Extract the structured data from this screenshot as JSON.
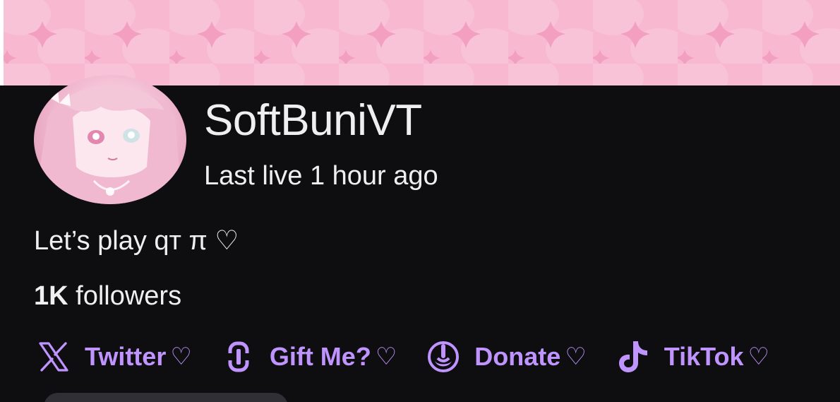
{
  "channel": {
    "name": "SoftBuniVT",
    "last_live": "Last live 1 hour ago",
    "bio": "Let’s play qт π ♡",
    "followers_count": "1K",
    "followers_label": " followers"
  },
  "links": [
    {
      "icon": "x-logo-icon",
      "label": "Twitter",
      "suffix": " ♡"
    },
    {
      "icon": "gift-link-icon",
      "label": "Gift Me?",
      "suffix": " ♡"
    },
    {
      "icon": "donate-icon",
      "label": "Donate",
      "suffix": " ♡"
    },
    {
      "icon": "tiktok-icon",
      "label": "TikTok",
      "suffix": " ♡"
    }
  ],
  "colors": {
    "background": "#0e0e10",
    "banner": "#f7b7cf",
    "link_accent": "#bf94ff",
    "text": "#efeff1"
  }
}
